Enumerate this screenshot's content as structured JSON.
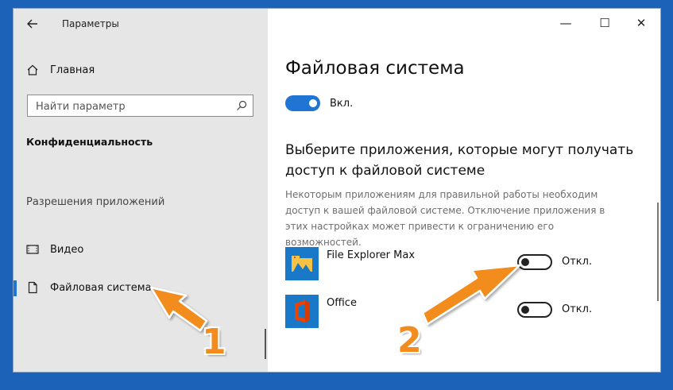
{
  "window": {
    "title": "Параметры",
    "controls": {
      "minimize": "—",
      "maximize": "☐",
      "close": "✕"
    }
  },
  "sidebar": {
    "home_label": "Главная",
    "search_placeholder": "Найти параметр",
    "section_title": "Конфиденциальность",
    "group_title": "Разрешения приложений",
    "items": [
      {
        "label": "Видео",
        "icon": "video-icon",
        "active": false
      },
      {
        "label": "Файловая система",
        "icon": "document-icon",
        "active": true
      }
    ]
  },
  "main": {
    "title": "Файловая система",
    "master_toggle": {
      "state": "on",
      "label": "Вкл."
    },
    "subtitle": "Выберите приложения, которые могут получать доступ к файловой системе",
    "description": "Некоторым приложениям для правильной работы необходим доступ к вашей файловой системе. Отключение приложения в этих настройках может привести к ограничению его возможностей.",
    "apps": [
      {
        "name": "File Explorer Max",
        "toggle_label": "Откл.",
        "state": "off",
        "icon": "file-explorer-max-icon"
      },
      {
        "name": "Office",
        "toggle_label": "Откл.",
        "state": "off",
        "icon": "office-icon"
      }
    ]
  },
  "annotations": {
    "marker1": "1",
    "marker2": "2",
    "arrow_color": "#f28c1e"
  },
  "colors": {
    "accent": "#1f74d4",
    "sidebar_bg": "#e6e6e6",
    "desktop_bg": "#1c62b8"
  }
}
